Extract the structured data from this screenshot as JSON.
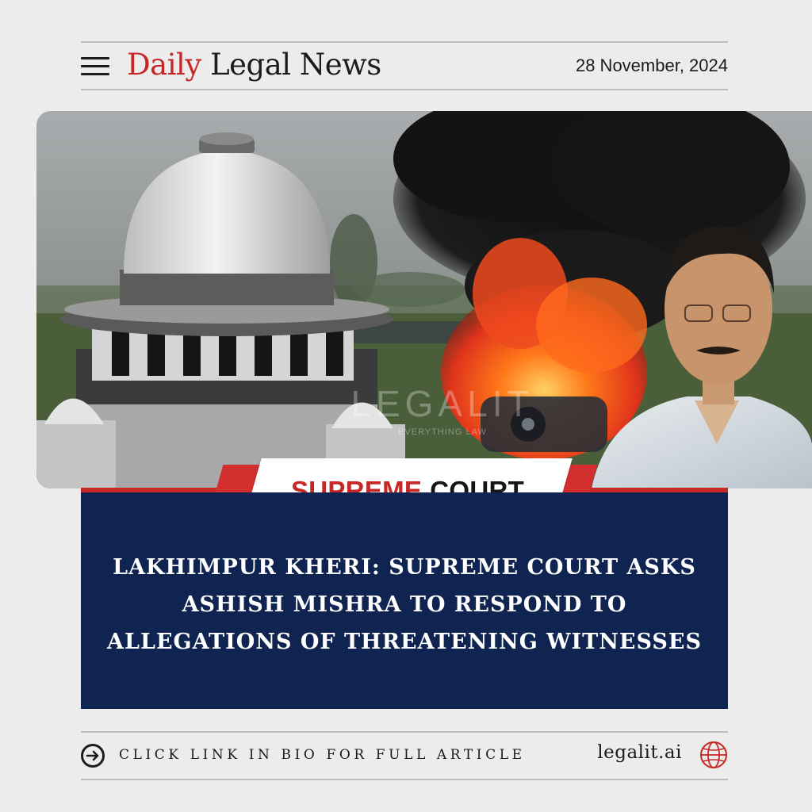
{
  "header": {
    "brand_accent": "Daily",
    "brand_rest": "Legal News",
    "date": "28 November, 2024"
  },
  "hero": {
    "watermark_main": "LEGALIT",
    "watermark_sub": "EVERYTHING LAW"
  },
  "category": {
    "part1": "SUPREME",
    "part2": "COURT"
  },
  "headline": {
    "line1": "LAKHIMPUR KHERI: SUPREME COURT ASKS",
    "line2": "ASHISH MISHRA TO RESPOND TO",
    "line3": "ALLEGATIONS OF THREATENING WITNESSES"
  },
  "footer": {
    "cta": "CLICK LINK IN BIO FOR FULL ARTICLE",
    "site": "legalit.ai"
  },
  "icons": {
    "menu": "hamburger-menu-icon",
    "arrow": "arrow-right-circle-icon",
    "globe": "globe-icon"
  },
  "colors": {
    "accent_red": "#c62828",
    "navy": "#0f2451",
    "background": "#ececec"
  }
}
